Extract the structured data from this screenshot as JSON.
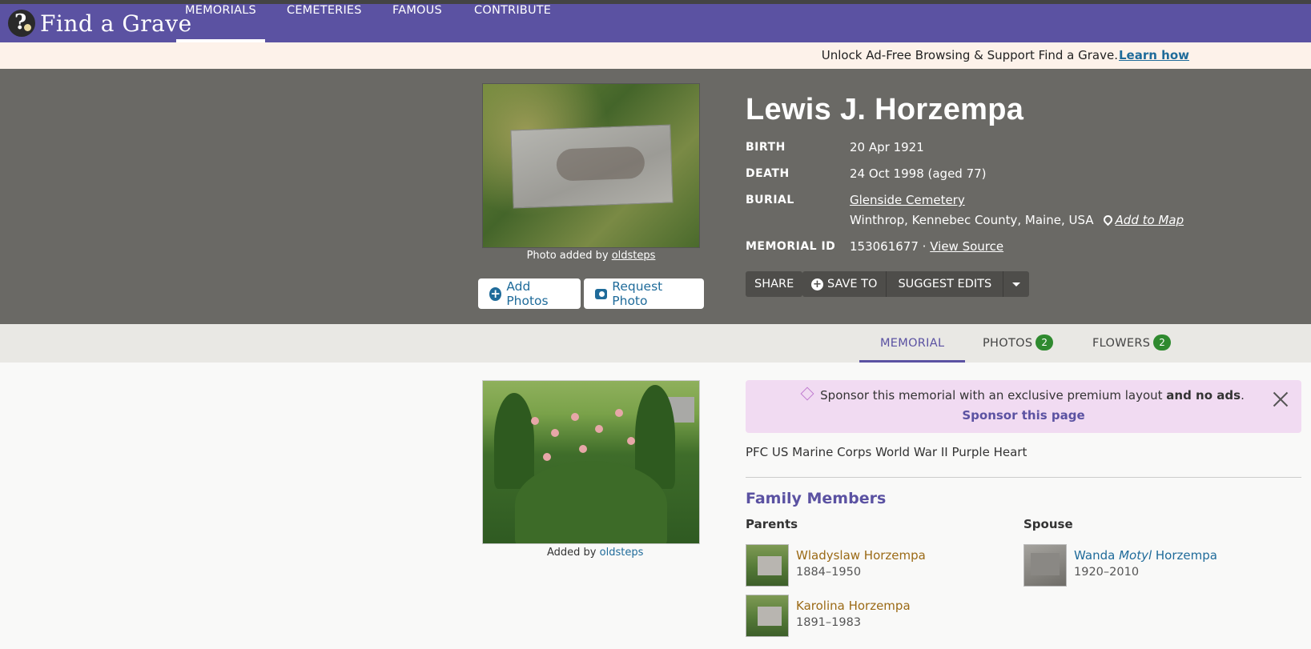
{
  "nav": {
    "logo_text": "Find a Grave",
    "items": [
      "MEMORIALS",
      "CEMETERIES",
      "FAMOUS",
      "CONTRIBUTE"
    ]
  },
  "promo": {
    "text": "Unlock Ad-Free Browsing & Support Find a Grave.",
    "link": "Learn how"
  },
  "hero": {
    "photo_caption_prefix": "Photo added by",
    "photo_caption_user": "oldsteps",
    "add_photos": "Add Photos",
    "request_photo": "Request Photo",
    "name": "Lewis J. Horzempa",
    "facts": {
      "birth_label": "BIRTH",
      "birth_value": "20 Apr 1921",
      "death_label": "DEATH",
      "death_value": "24 Oct 1998 (aged 77)",
      "burial_label": "BURIAL",
      "burial_cemetery": "Glenside Cemetery",
      "burial_location": "Winthrop, Kennebec County, Maine, USA",
      "add_to_map": "Add to Map",
      "memorial_label": "MEMORIAL ID",
      "memorial_id": "153061677 ·",
      "view_source": "View Source"
    },
    "share": "SHARE",
    "save_to": "SAVE TO",
    "suggest_edits": "SUGGEST EDITS"
  },
  "tabs": [
    {
      "label": "MEMORIAL"
    },
    {
      "label": "PHOTOS",
      "count": "2"
    },
    {
      "label": "FLOWERS",
      "count": "2"
    }
  ],
  "flower": {
    "caption_prefix": "Added by",
    "caption_user": "oldsteps"
  },
  "sponsor": {
    "text": "Sponsor this memorial with an exclusive premium layout",
    "bold": "and no ads",
    "end": ".",
    "link": "Sponsor this page"
  },
  "bio": "PFC US Marine Corps World War II Purple Heart",
  "family": {
    "title": "Family Members",
    "parents_label": "Parents",
    "spouse_label": "Spouse",
    "parents": [
      {
        "name": "Wladyslaw Horzempa",
        "dates": "1884–1950"
      },
      {
        "name": "Karolina Horzempa",
        "dates": "1891–1983"
      }
    ],
    "spouse": {
      "first": "Wanda",
      "maiden": "Motyl",
      "last": "Horzempa",
      "dates": "1920–2010"
    }
  },
  "colors": {
    "brand_purple": "#5b52a2",
    "link_blue": "#1f6b9a",
    "badge_green": "#2f8a2f",
    "hero_bg": "#6a6965"
  }
}
